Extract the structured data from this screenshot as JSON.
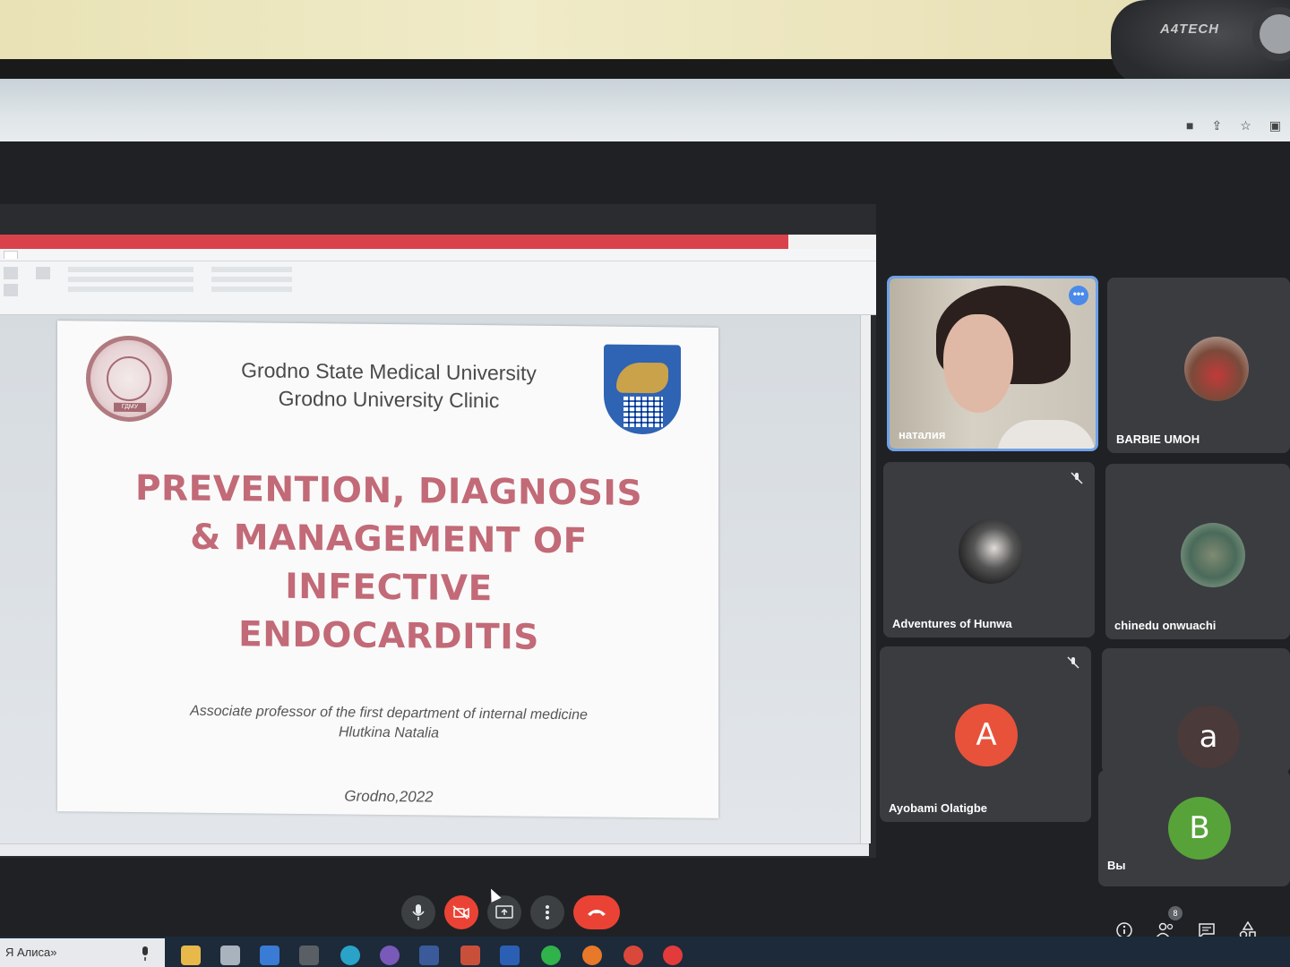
{
  "webcam": {
    "brand": "A4TECH"
  },
  "slide": {
    "university": [
      "Grodno State Medical University",
      "Grodno University Clinic"
    ],
    "logo_text": "ГДМУ",
    "title_lines": [
      "PREVENTION, DIAGNOSIS",
      "& MANAGEMENT OF",
      "INFECTIVE",
      "ENDOCARDITIS"
    ],
    "author_lines": [
      "Associate professor of the first department of internal medicine",
      "Hlutkina Natalia"
    ],
    "place_date": "Grodno,2022"
  },
  "participants": [
    {
      "name": "наталия",
      "kind": "video",
      "active": true
    },
    {
      "name": "BARBIE UMOH",
      "kind": "photo"
    },
    {
      "name": "Adventures of Hunwa",
      "kind": "photo",
      "muted": true
    },
    {
      "name": "chinedu onwuachi",
      "kind": "photo"
    },
    {
      "name": "Ayobami Olatigbe",
      "kind": "letter",
      "letter": "A",
      "color": "#e8523a",
      "muted": true
    },
    {
      "name": "",
      "kind": "letter",
      "letter": "a",
      "color": "#4a3a3a"
    },
    {
      "name": "Вы",
      "kind": "letter",
      "letter": "B",
      "color": "#57a33a"
    }
  ],
  "controls": {
    "participants_count": "8"
  },
  "taskbar": {
    "search_text": "Я Алиса»"
  },
  "colors": {
    "title": "#c26a77",
    "hangup": "#ea4335",
    "active_border": "#6ea1e8"
  }
}
